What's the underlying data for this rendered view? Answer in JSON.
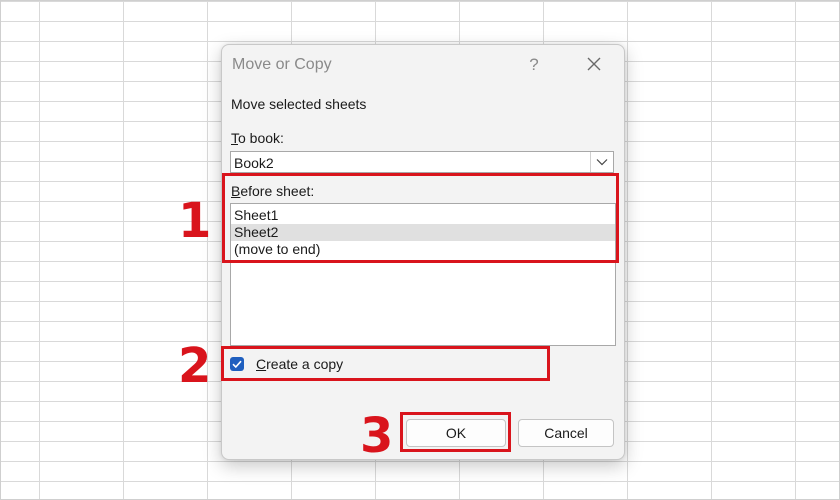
{
  "dialog": {
    "title": "Move or Copy",
    "help_label": "?",
    "close_icon": "close-icon",
    "subtitle": "Move selected sheets",
    "to_book": {
      "label_mnemonic": "T",
      "label_rest": "o book:",
      "value": "Book2",
      "dropdown_icon": "chevron-down-icon"
    },
    "before_sheet": {
      "label_mnemonic": "B",
      "label_rest": "efore sheet:",
      "items": [
        {
          "label": "Sheet1",
          "selected": false
        },
        {
          "label": "Sheet2",
          "selected": true
        },
        {
          "label": "(move to end)",
          "selected": false
        }
      ]
    },
    "create_copy": {
      "label_mnemonic": "C",
      "label_rest": "reate a copy",
      "checked": true
    },
    "ok_label": "OK",
    "cancel_label": "Cancel"
  },
  "annotations": {
    "steps": [
      "1",
      "2",
      "3"
    ],
    "color": "#d9141c"
  },
  "colors": {
    "accent": "#1f5fbf",
    "selection": "#e0e0e0",
    "dialog_bg": "#f3f3f3"
  }
}
